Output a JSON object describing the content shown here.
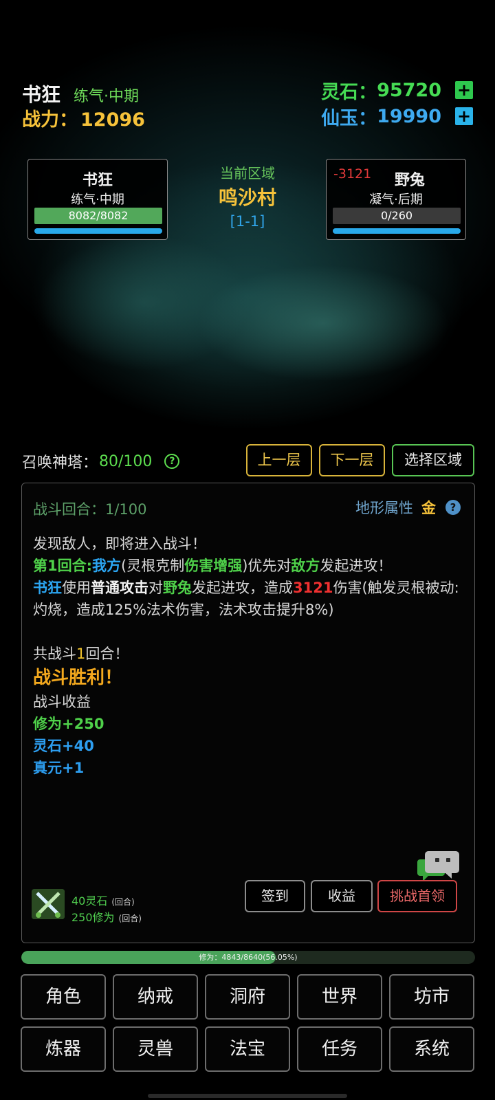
{
  "player": {
    "name": "书狂",
    "realm": "练气·中期",
    "power_label": "战力：",
    "power_value": "12096"
  },
  "currency": {
    "stone_label": "灵石：",
    "stone_value": "95720",
    "jade_label": "仙玉：",
    "jade_value": "19990",
    "plus": "+"
  },
  "battle": {
    "player_card": {
      "name": "书狂",
      "realm": "练气·中期",
      "hp": "8082/8082"
    },
    "enemy_card": {
      "damage": "-3121",
      "name": "野兔",
      "realm": "凝气·后期",
      "hp": "0/260"
    },
    "area_label": "当前区域",
    "area_name": "鸣沙村",
    "area_code": "[1-1]"
  },
  "tower": {
    "label": "召唤神塔：",
    "value": "80/100",
    "help": "?"
  },
  "floor_buttons": {
    "prev": "上一层",
    "next": "下一层",
    "select": "选择区域"
  },
  "log": {
    "round_label": "战斗回合：1/100",
    "terrain_label": "地形属性",
    "terrain_value": "金",
    "help": "?",
    "l1": "发现敌人，即将进入战斗！",
    "l2_round": "第1回合:",
    "l2_me": "我方",
    "l2_a": "(灵根克制",
    "l2_boost": "伤害增强",
    "l2_b": ")优先对",
    "l2_enemy": "敌方",
    "l2_c": "发起进攻！",
    "l3_name": "书狂",
    "l3_a": "使用",
    "l3_skill": "普通攻击",
    "l3_b": "对",
    "l3_target": "野兔",
    "l3_c": "发起进攻，造成",
    "l3_dmg": "3121",
    "l3_d": "伤害(触发灵根被动: 灼烧，造成125%法术伤害，法术攻击提升8%)",
    "l4_a": "共战斗",
    "l4_n": "1",
    "l4_b": "回合！",
    "victory": "战斗胜利！",
    "rewards_title": "战斗收益",
    "r1": "修为+250",
    "r2": "灵石+40",
    "r3": "真元+1"
  },
  "idle_reward": {
    "stone": "40灵石",
    "cult": "250修为",
    "unit": "(回合)"
  },
  "log_buttons": {
    "signin": "签到",
    "income": "收益",
    "boss": "挑战首领"
  },
  "xp_bar": {
    "label": "修为：4843/8640(56.05%)",
    "fraction": 0.5605
  },
  "nav": [
    "角色",
    "纳戒",
    "洞府",
    "世界",
    "坊市",
    "炼器",
    "灵兽",
    "法宝",
    "任务",
    "系统"
  ]
}
